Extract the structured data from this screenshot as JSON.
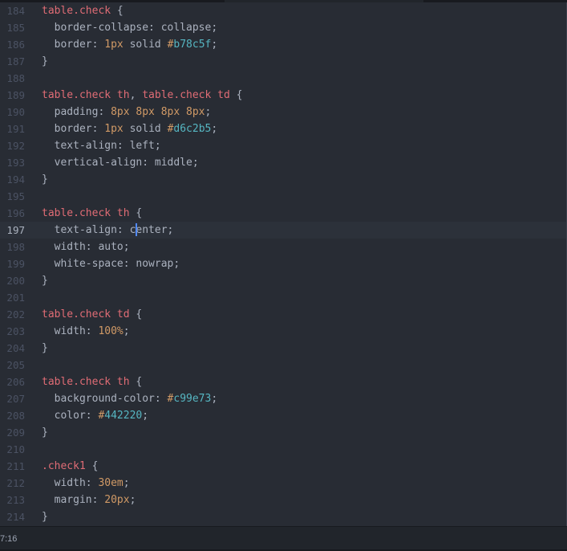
{
  "colors": {
    "background": "#282c34",
    "gutter_number": "#4b5263",
    "selector": "#e06c75",
    "number": "#d19a66",
    "hex": "#56b6c2",
    "text": "#abb2bf",
    "caret": "#528bff"
  },
  "editor": {
    "cursor_line": "197",
    "lines": [
      {
        "no": "184",
        "tokens": [
          {
            "t": "table.check",
            "k": "sel"
          },
          {
            "t": " {",
            "k": "text"
          }
        ]
      },
      {
        "no": "185",
        "tokens": [
          {
            "t": "  border-collapse: collapse;",
            "k": "text"
          }
        ]
      },
      {
        "no": "186",
        "tokens": [
          {
            "t": "  border: ",
            "k": "text"
          },
          {
            "t": "1px",
            "k": "num"
          },
          {
            "t": " solid ",
            "k": "text"
          },
          {
            "t": "#",
            "k": "num"
          },
          {
            "t": "b78c5f",
            "k": "hex"
          },
          {
            "t": ";",
            "k": "text"
          }
        ]
      },
      {
        "no": "187",
        "tokens": [
          {
            "t": "}",
            "k": "text"
          }
        ]
      },
      {
        "no": "188",
        "tokens": []
      },
      {
        "no": "189",
        "tokens": [
          {
            "t": "table.check th",
            "k": "sel"
          },
          {
            "t": ", ",
            "k": "text"
          },
          {
            "t": "table.check td",
            "k": "sel"
          },
          {
            "t": " {",
            "k": "text"
          }
        ]
      },
      {
        "no": "190",
        "tokens": [
          {
            "t": "  padding: ",
            "k": "text"
          },
          {
            "t": "8px 8px 8px 8px",
            "k": "num"
          },
          {
            "t": ";",
            "k": "text"
          }
        ]
      },
      {
        "no": "191",
        "tokens": [
          {
            "t": "  border: ",
            "k": "text"
          },
          {
            "t": "1px",
            "k": "num"
          },
          {
            "t": " solid ",
            "k": "text"
          },
          {
            "t": "#",
            "k": "num"
          },
          {
            "t": "d6c2b5",
            "k": "hex"
          },
          {
            "t": ";",
            "k": "text"
          }
        ]
      },
      {
        "no": "192",
        "tokens": [
          {
            "t": "  text-align: left;",
            "k": "text"
          }
        ]
      },
      {
        "no": "193",
        "tokens": [
          {
            "t": "  vertical-align: middle;",
            "k": "text"
          }
        ]
      },
      {
        "no": "194",
        "tokens": [
          {
            "t": "}",
            "k": "text"
          }
        ]
      },
      {
        "no": "195",
        "tokens": []
      },
      {
        "no": "196",
        "tokens": [
          {
            "t": "table.check th",
            "k": "sel"
          },
          {
            "t": " {",
            "k": "text"
          }
        ]
      },
      {
        "no": "197",
        "tokens": [
          {
            "t": "  text-align: c",
            "k": "text"
          },
          {
            "t": "",
            "k": "caret"
          },
          {
            "t": "enter;",
            "k": "text"
          }
        ]
      },
      {
        "no": "198",
        "tokens": [
          {
            "t": "  width: auto;",
            "k": "text"
          }
        ]
      },
      {
        "no": "199",
        "tokens": [
          {
            "t": "  white-space: nowrap;",
            "k": "text"
          }
        ]
      },
      {
        "no": "200",
        "tokens": [
          {
            "t": "}",
            "k": "text"
          }
        ]
      },
      {
        "no": "201",
        "tokens": []
      },
      {
        "no": "202",
        "tokens": [
          {
            "t": "table.check td",
            "k": "sel"
          },
          {
            "t": " {",
            "k": "text"
          }
        ]
      },
      {
        "no": "203",
        "tokens": [
          {
            "t": "  width: ",
            "k": "text"
          },
          {
            "t": "100%",
            "k": "num"
          },
          {
            "t": ";",
            "k": "text"
          }
        ]
      },
      {
        "no": "204",
        "tokens": [
          {
            "t": "}",
            "k": "text"
          }
        ]
      },
      {
        "no": "205",
        "tokens": []
      },
      {
        "no": "206",
        "tokens": [
          {
            "t": "table.check th",
            "k": "sel"
          },
          {
            "t": " {",
            "k": "text"
          }
        ]
      },
      {
        "no": "207",
        "tokens": [
          {
            "t": "  background-color: ",
            "k": "text"
          },
          {
            "t": "#",
            "k": "num"
          },
          {
            "t": "c99e73",
            "k": "hex"
          },
          {
            "t": ";",
            "k": "text"
          }
        ]
      },
      {
        "no": "208",
        "tokens": [
          {
            "t": "  color: ",
            "k": "text"
          },
          {
            "t": "#",
            "k": "num"
          },
          {
            "t": "442220",
            "k": "hex"
          },
          {
            "t": ";",
            "k": "text"
          }
        ]
      },
      {
        "no": "209",
        "tokens": [
          {
            "t": "}",
            "k": "text"
          }
        ]
      },
      {
        "no": "210",
        "tokens": []
      },
      {
        "no": "211",
        "tokens": [
          {
            "t": ".check1",
            "k": "sel"
          },
          {
            "t": " {",
            "k": "text"
          }
        ]
      },
      {
        "no": "212",
        "tokens": [
          {
            "t": "  width: ",
            "k": "text"
          },
          {
            "t": "30em",
            "k": "num"
          },
          {
            "t": ";",
            "k": "text"
          }
        ]
      },
      {
        "no": "213",
        "tokens": [
          {
            "t": "  margin: ",
            "k": "text"
          },
          {
            "t": "20px",
            "k": "num"
          },
          {
            "t": ";",
            "k": "text"
          }
        ]
      },
      {
        "no": "214",
        "tokens": [
          {
            "t": "}",
            "k": "text"
          }
        ]
      }
    ]
  },
  "statusbar": {
    "cursor_position": "7:16"
  }
}
